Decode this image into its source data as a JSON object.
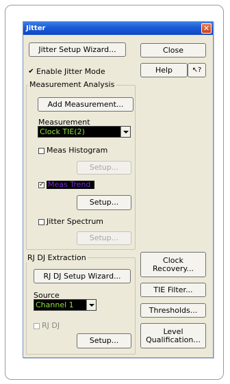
{
  "window": {
    "title": "Jitter"
  },
  "buttons": {
    "setup_wizard": "Jitter Setup Wizard...",
    "close": "Close",
    "help": "Help",
    "whats_this": "↖?",
    "add_measurement": "Add Measurement...",
    "histogram_setup": "Setup...",
    "trend_setup": "Setup...",
    "spectrum_setup": "Setup...",
    "rjdj_wizard": "RJ DJ Setup Wizard...",
    "rjdj_setup": "Setup...",
    "clock_recovery": "Clock Recovery...",
    "tie_filter": "TIE Filter...",
    "thresholds": "Thresholds...",
    "level_qualification": "Level Qualification..."
  },
  "enable_jitter": {
    "label": "Enable Jitter Mode",
    "checked": true
  },
  "measurement_analysis": {
    "caption": "Measurement Analysis",
    "measurement_label": "Measurement",
    "measurement_value": "Clock TIE(2)",
    "histogram": {
      "label": "Meas Histogram",
      "checked": false
    },
    "trend": {
      "label": "Meas Trend",
      "checked": true
    },
    "spectrum": {
      "label": "Jitter Spectrum",
      "checked": false
    }
  },
  "rjdj": {
    "caption": "RJ DJ Extraction",
    "source_label": "Source",
    "source_value": "Channel 1",
    "rjdj_check": {
      "label": "RJ DJ",
      "checked": false
    }
  },
  "colors": {
    "title_bar": "#1a59d6",
    "dialog_bg": "#ece9d8",
    "select_text": "#8ee23c",
    "trend_text": "#7a2bd8"
  }
}
